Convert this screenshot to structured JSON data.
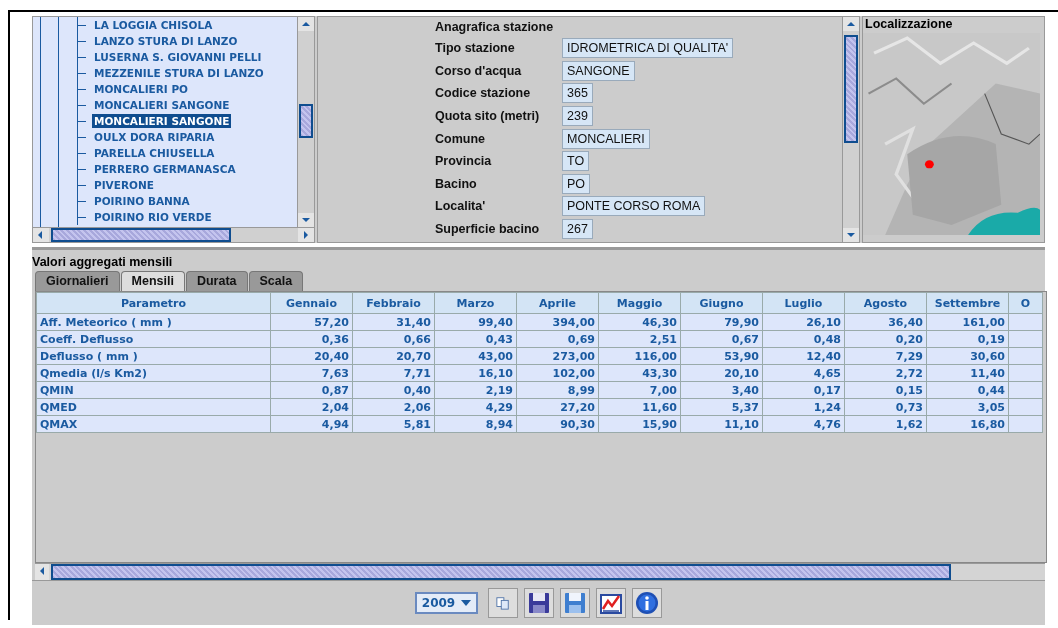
{
  "tree": {
    "items": [
      {
        "label": "LA LOGGIA CHISOLA",
        "selected": false
      },
      {
        "label": "LANZO STURA DI LANZO",
        "selected": false
      },
      {
        "label": "LUSERNA S. GIOVANNI PELLI",
        "selected": false
      },
      {
        "label": "MEZZENILE STURA DI LANZO",
        "selected": false
      },
      {
        "label": "MONCALIERI PO",
        "selected": false
      },
      {
        "label": "MONCALIERI SANGONE",
        "selected": false
      },
      {
        "label": "MONCALIERI SANGONE",
        "selected": true
      },
      {
        "label": "OULX DORA RIPARIA",
        "selected": false
      },
      {
        "label": "PARELLA CHIUSELLA",
        "selected": false
      },
      {
        "label": "PERRERO GERMANASCA",
        "selected": false
      },
      {
        "label": "PIVERONE",
        "selected": false
      },
      {
        "label": "POIRINO BANNA",
        "selected": false
      },
      {
        "label": "POIRINO RIO VERDE",
        "selected": false
      }
    ]
  },
  "station": {
    "title": "Anagrafica stazione",
    "fields": [
      {
        "label": "Tipo stazione",
        "value": "IDROMETRICA DI QUALITA'"
      },
      {
        "label": "Corso d'acqua",
        "value": "SANGONE"
      },
      {
        "label": "Codice stazione",
        "value": "365"
      },
      {
        "label": "Quota sito (metri)",
        "value": "239"
      },
      {
        "label": "Comune",
        "value": "MONCALIERI"
      },
      {
        "label": "Provincia",
        "value": "TO"
      },
      {
        "label": "Bacino",
        "value": "PO"
      },
      {
        "label": "Localita'",
        "value": "PONTE CORSO ROMA"
      },
      {
        "label": "Superficie bacino",
        "value": "267"
      }
    ]
  },
  "map": {
    "title": "Localizzazione",
    "kind": "picture"
  },
  "monthly": {
    "title": "Valori aggregati mensili",
    "tabs": [
      {
        "label": "Giornalieri",
        "selected": false
      },
      {
        "label": "Mensili",
        "selected": true
      },
      {
        "label": "Durata",
        "selected": false
      },
      {
        "label": "Scala",
        "selected": false
      }
    ],
    "columns": [
      "Parametro",
      "Gennaio",
      "Febbraio",
      "Marzo",
      "Aprile",
      "Maggio",
      "Giugno",
      "Luglio",
      "Agosto",
      "Settembre",
      "O"
    ],
    "rows": [
      {
        "name": "Aff. Meteorico ( mm )",
        "values": [
          "57,20",
          "31,40",
          "99,40",
          "394,00",
          "46,30",
          "79,90",
          "26,10",
          "36,40",
          "161,00"
        ]
      },
      {
        "name": "Coeff. Deflusso",
        "values": [
          "0,36",
          "0,66",
          "0,43",
          "0,69",
          "2,51",
          "0,67",
          "0,48",
          "0,20",
          "0,19"
        ]
      },
      {
        "name": "Deflusso ( mm )",
        "values": [
          "20,40",
          "20,70",
          "43,00",
          "273,00",
          "116,00",
          "53,90",
          "12,40",
          "7,29",
          "30,60"
        ]
      },
      {
        "name": "Qmedia (l/s Km2)",
        "values": [
          "7,63",
          "7,71",
          "16,10",
          "102,00",
          "43,30",
          "20,10",
          "4,65",
          "2,72",
          "11,40"
        ]
      },
      {
        "name": "QMIN",
        "values": [
          "0,87",
          "0,40",
          "2,19",
          "8,99",
          "7,00",
          "3,40",
          "0,17",
          "0,15",
          "0,44"
        ]
      },
      {
        "name": "QMED",
        "values": [
          "2,04",
          "2,06",
          "4,29",
          "27,20",
          "11,60",
          "5,37",
          "1,24",
          "0,73",
          "3,05"
        ]
      },
      {
        "name": "QMAX",
        "values": [
          "4,94",
          "5,81",
          "8,94",
          "90,30",
          "15,90",
          "11,10",
          "4,76",
          "1,62",
          "16,80"
        ]
      }
    ]
  },
  "toolbar": {
    "year": "2009"
  }
}
